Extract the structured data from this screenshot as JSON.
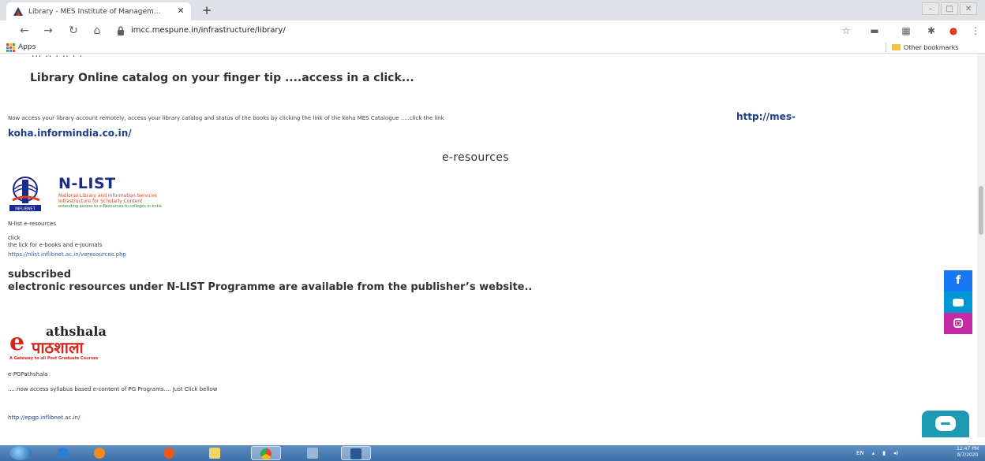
{
  "browser": {
    "tab_title": "Library - MES Institute of Management",
    "tab_close": "✕",
    "new_tab": "+",
    "url": "imcc.mespune.in/infrastructure/library/",
    "apps_label": "Apps",
    "other_bookmarks": "Other bookmarks"
  },
  "page": {
    "cut_text": "...  ..  .  ..  .  .",
    "catalog_heading": "Library Online catalog on your finger tip ....access in a click...",
    "access_text": "Now access your library account remotely, access your library catalog and  status of the books by clicking the link of the koha MES Catalogue .....click the link",
    "koha_link_part1": "http://mes-",
    "koha_link_part2": "koha.informindia.co.in/",
    "eresources_heading": "e-resources",
    "nlist_logo": {
      "title": "N-LIST",
      "line1": "National Library and Information Services",
      "line2": "Infrastructure for Scholarly Content",
      "line3": "extending access to e-Resources to colleges in India",
      "emblem_caption": "INFLIBNET"
    },
    "nlist_caption": "N-list e-resources",
    "click_text": "click",
    "lick_text": "the lick for e-books and e-journals",
    "nlist_url": "https://nlist.inflibnet.ac.in/veresources.php",
    "subscribed_heading": "subscribed\nelectronic resources under N-LIST Programme are available from the publisher’s website..",
    "epg_logo": {
      "e": "e",
      "name": "athshala",
      "hindi": "पाठशाला",
      "tagline": "A Gateway to all Post Graduate Courses"
    },
    "epg_caption": "e-PGPathshala",
    "epg_text": ".....now access syllabus based e-content of PG Programs.... Just Click bellow",
    "epg_url": "http://epgp.inflibnet.ac.in/"
  },
  "social": {
    "facebook_glyph": "f"
  },
  "taskbar": {
    "lang": "EN",
    "time": "12:47 PM",
    "date": "9/7/2020"
  },
  "colors": {
    "link": "#1f3c88",
    "facebook": "#1877f2",
    "youtube": "#0096d6",
    "instagram": "#c32aa3",
    "chat": "#1f9ab3"
  }
}
